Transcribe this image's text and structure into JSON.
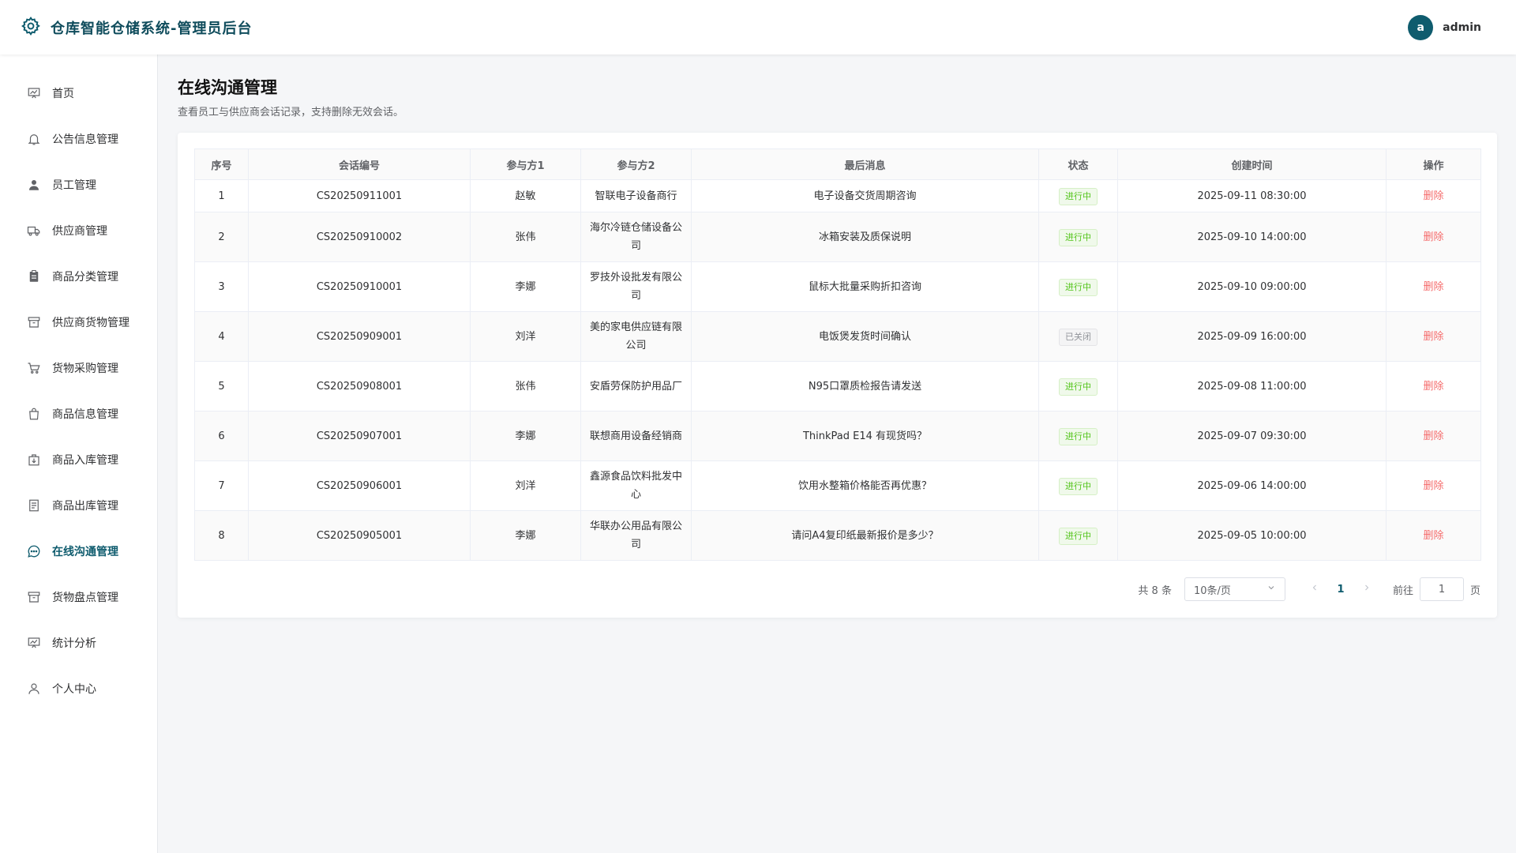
{
  "header": {
    "title": "仓库智能仓储系统-管理员后台",
    "avatar_letter": "a",
    "username": "admin"
  },
  "sidebar": {
    "items": [
      {
        "label": "首页",
        "icon": "chart-board-icon"
      },
      {
        "label": "公告信息管理",
        "icon": "bell-icon"
      },
      {
        "label": "员工管理",
        "icon": "user-filled-icon"
      },
      {
        "label": "供应商管理",
        "icon": "truck-icon"
      },
      {
        "label": "商品分类管理",
        "icon": "clipboard-icon"
      },
      {
        "label": "供应商货物管理",
        "icon": "box-icon"
      },
      {
        "label": "货物采购管理",
        "icon": "cart-icon"
      },
      {
        "label": "商品信息管理",
        "icon": "bag-icon"
      },
      {
        "label": "商品入库管理",
        "icon": "inbound-icon"
      },
      {
        "label": "商品出库管理",
        "icon": "document-icon"
      },
      {
        "label": "在线沟通管理",
        "icon": "chat-icon"
      },
      {
        "label": "货物盘点管理",
        "icon": "box-icon"
      },
      {
        "label": "统计分析",
        "icon": "chart-board-icon"
      },
      {
        "label": "个人中心",
        "icon": "user-icon"
      }
    ],
    "active_index": 10
  },
  "page": {
    "title": "在线沟通管理",
    "description": "查看员工与供应商会话记录，支持删除无效会话。"
  },
  "table": {
    "columns": [
      "序号",
      "会话编号",
      "参与方1",
      "参与方2",
      "最后消息",
      "状态",
      "创建时间",
      "操作"
    ],
    "rows": [
      {
        "no": "1",
        "code": "CS20250911001",
        "p1": "赵敏",
        "p2": "智联电子设备商行",
        "msg": "电子设备交货周期咨询",
        "status": "进行中",
        "time": "2025-09-11 08:30:00",
        "action": "删除"
      },
      {
        "no": "2",
        "code": "CS20250910002",
        "p1": "张伟",
        "p2": "海尔冷链仓储设备公司",
        "msg": "冰箱安装及质保说明",
        "status": "进行中",
        "time": "2025-09-10 14:00:00",
        "action": "删除"
      },
      {
        "no": "3",
        "code": "CS20250910001",
        "p1": "李娜",
        "p2": "罗技外设批发有限公司",
        "msg": "鼠标大批量采购折扣咨询",
        "status": "进行中",
        "time": "2025-09-10 09:00:00",
        "action": "删除"
      },
      {
        "no": "4",
        "code": "CS20250909001",
        "p1": "刘洋",
        "p2": "美的家电供应链有限公司",
        "msg": "电饭煲发货时间确认",
        "status": "已关闭",
        "time": "2025-09-09 16:00:00",
        "action": "删除"
      },
      {
        "no": "5",
        "code": "CS20250908001",
        "p1": "张伟",
        "p2": "安盾劳保防护用品厂",
        "msg": "N95口罩质检报告请发送",
        "status": "进行中",
        "time": "2025-09-08 11:00:00",
        "action": "删除"
      },
      {
        "no": "6",
        "code": "CS20250907001",
        "p1": "李娜",
        "p2": "联想商用设备经销商",
        "msg": "ThinkPad E14 有现货吗？",
        "status": "进行中",
        "time": "2025-09-07 09:30:00",
        "action": "删除"
      },
      {
        "no": "7",
        "code": "CS20250906001",
        "p1": "刘洋",
        "p2": "鑫源食品饮料批发中心",
        "msg": "饮用水整箱价格能否再优惠？",
        "status": "进行中",
        "time": "2025-09-06 14:00:00",
        "action": "删除"
      },
      {
        "no": "8",
        "code": "CS20250905001",
        "p1": "李娜",
        "p2": "华联办公用品有限公司",
        "msg": "请问A4复印纸最新报价是多少？",
        "status": "进行中",
        "time": "2025-09-05 10:00:00",
        "action": "删除"
      }
    ]
  },
  "pagination": {
    "total": "共 8 条",
    "page_size": "10条/页",
    "current": "1",
    "goto_label": "前往",
    "goto_value": "1",
    "goto_suffix": "页"
  },
  "colors": {
    "primary": "#0f5c6e",
    "danger": "#f56c6c",
    "success": "#52c41a"
  }
}
